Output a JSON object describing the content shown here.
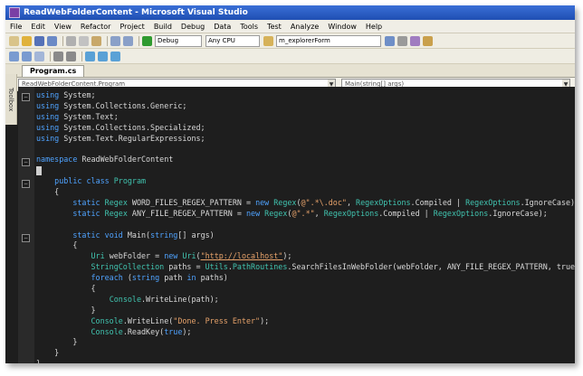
{
  "window": {
    "title": "ReadWebFolderContent - Microsoft Visual Studio"
  },
  "menu": [
    "File",
    "Edit",
    "View",
    "Refactor",
    "Project",
    "Build",
    "Debug",
    "Data",
    "Tools",
    "Test",
    "Analyze",
    "Window",
    "Help"
  ],
  "toolbar": {
    "config": "Debug",
    "platform": "Any CPU",
    "find": "m_explorerForm"
  },
  "tabs": [
    {
      "label": "Program.cs"
    }
  ],
  "side": {
    "toolbox": "Toolbox"
  },
  "navbar": {
    "class_combo": "ReadWebFolderContent.Program",
    "member_combo": "Main(string[] args)"
  },
  "code_lines": [
    [
      [
        "kw",
        "using"
      ],
      [
        "t",
        " System;"
      ]
    ],
    [
      [
        "kw",
        "using"
      ],
      [
        "t",
        " System.Collections.Generic;"
      ]
    ],
    [
      [
        "kw",
        "using"
      ],
      [
        "t",
        " System.Text;"
      ]
    ],
    [
      [
        "kw",
        "using"
      ],
      [
        "t",
        " System.Collections.Specialized;"
      ]
    ],
    [
      [
        "kw",
        "using"
      ],
      [
        "t",
        " System.Text.RegularExpressions;"
      ]
    ],
    [],
    [
      [
        "kw",
        "namespace"
      ],
      [
        "t",
        " ReadWebFolderContent"
      ]
    ],
    [
      [
        "cursor",
        ""
      ]
    ],
    [
      [
        "t",
        "    "
      ],
      [
        "kw",
        "public"
      ],
      [
        "t",
        " "
      ],
      [
        "kw",
        "class"
      ],
      [
        "t",
        " "
      ],
      [
        "ty",
        "Program"
      ]
    ],
    [
      [
        "t",
        "    {"
      ]
    ],
    [
      [
        "t",
        "        "
      ],
      [
        "kw",
        "static"
      ],
      [
        "t",
        " "
      ],
      [
        "ty",
        "Regex"
      ],
      [
        "t",
        " WORD_FILES_REGEX_PATTERN = "
      ],
      [
        "kw",
        "new"
      ],
      [
        "t",
        " "
      ],
      [
        "ty",
        "Regex"
      ],
      [
        "t",
        "("
      ],
      [
        "str",
        "@\".*\\.doc\""
      ],
      [
        "t",
        ", "
      ],
      [
        "ty",
        "RegexOptions"
      ],
      [
        "t",
        ".Compiled | "
      ],
      [
        "ty",
        "RegexOptions"
      ],
      [
        "t",
        ".IgnoreCase);"
      ]
    ],
    [
      [
        "t",
        "        "
      ],
      [
        "kw",
        "static"
      ],
      [
        "t",
        " "
      ],
      [
        "ty",
        "Regex"
      ],
      [
        "t",
        " ANY_FILE_REGEX_PATTERN = "
      ],
      [
        "kw",
        "new"
      ],
      [
        "t",
        " "
      ],
      [
        "ty",
        "Regex"
      ],
      [
        "t",
        "("
      ],
      [
        "str",
        "@\".*\""
      ],
      [
        "t",
        ", "
      ],
      [
        "ty",
        "RegexOptions"
      ],
      [
        "t",
        ".Compiled | "
      ],
      [
        "ty",
        "RegexOptions"
      ],
      [
        "t",
        ".IgnoreCase);"
      ]
    ],
    [],
    [
      [
        "t",
        "        "
      ],
      [
        "kw",
        "static"
      ],
      [
        "t",
        " "
      ],
      [
        "kw",
        "void"
      ],
      [
        "t",
        " Main("
      ],
      [
        "kw",
        "string"
      ],
      [
        "t",
        "[] args)"
      ]
    ],
    [
      [
        "t",
        "        {"
      ]
    ],
    [
      [
        "t",
        "            "
      ],
      [
        "ty",
        "Uri"
      ],
      [
        "t",
        " webFolder = "
      ],
      [
        "kw",
        "new"
      ],
      [
        "t",
        " "
      ],
      [
        "ty",
        "Uri"
      ],
      [
        "t",
        "("
      ],
      [
        "url",
        "\"http://localhost\""
      ],
      [
        "t",
        ");"
      ]
    ],
    [
      [
        "t",
        "            "
      ],
      [
        "ty",
        "StringCollection"
      ],
      [
        "t",
        " paths = "
      ],
      [
        "ty",
        "Utils"
      ],
      [
        "t",
        "."
      ],
      [
        "ty",
        "PathRoutines"
      ],
      [
        "t",
        ".SearchFilesInWebFolder(webFolder, ANY_FILE_REGEX_PATTERN, true);"
      ]
    ],
    [
      [
        "t",
        "            "
      ],
      [
        "kw",
        "foreach"
      ],
      [
        "t",
        " ("
      ],
      [
        "kw",
        "string"
      ],
      [
        "t",
        " path "
      ],
      [
        "kw",
        "in"
      ],
      [
        "t",
        " paths)"
      ]
    ],
    [
      [
        "t",
        "            {"
      ]
    ],
    [
      [
        "t",
        "                "
      ],
      [
        "ty",
        "Console"
      ],
      [
        "t",
        ".WriteLine(path);"
      ]
    ],
    [
      [
        "t",
        "            }"
      ]
    ],
    [
      [
        "t",
        "            "
      ],
      [
        "ty",
        "Console"
      ],
      [
        "t",
        ".WriteLine("
      ],
      [
        "str",
        "\"Done. Press Enter\""
      ],
      [
        "t",
        ");"
      ]
    ],
    [
      [
        "t",
        "            "
      ],
      [
        "ty",
        "Console"
      ],
      [
        "t",
        ".ReadKey("
      ],
      [
        "kw",
        "true"
      ],
      [
        "t",
        ");"
      ]
    ],
    [
      [
        "t",
        "        }"
      ]
    ],
    [
      [
        "t",
        "    }"
      ]
    ],
    [
      [
        "t",
        "}"
      ]
    ]
  ]
}
